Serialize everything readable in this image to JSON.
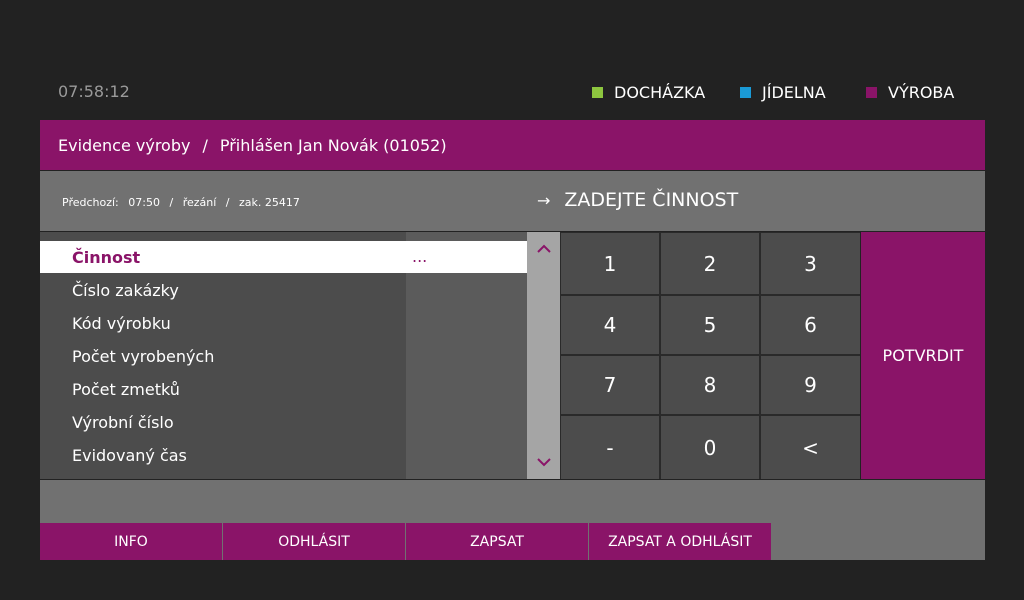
{
  "clock": "07:58:12",
  "modes": [
    {
      "label": "DOCHÁZKA",
      "color": "#8dc63f"
    },
    {
      "label": "JÍDELNA",
      "color": "#1a9ad6"
    },
    {
      "label": "VÝROBA",
      "color": "#8a1468"
    }
  ],
  "header": {
    "section": "Evidence výroby",
    "separator": "/",
    "user": "Přihlášen Jan Novák (01052)"
  },
  "previous": {
    "label": "Předchozí:",
    "time": "07:50",
    "sep": "/",
    "activity": "řezání",
    "order": "zak. 25417"
  },
  "prompt": {
    "arrow": "→",
    "text": "ZADEJTE ČINNOST"
  },
  "fields": [
    {
      "label": "Činnost",
      "value": "..."
    },
    {
      "label": "Číslo zakázky",
      "value": ""
    },
    {
      "label": "Kód výrobku",
      "value": ""
    },
    {
      "label": "Počet vyrobených",
      "value": ""
    },
    {
      "label": "Počet zmetků",
      "value": ""
    },
    {
      "label": "Výrobní číslo",
      "value": ""
    },
    {
      "label": "Evidovaný čas",
      "value": ""
    }
  ],
  "scroll": {
    "up": "⌃",
    "down": "⌄"
  },
  "keypad": [
    "1",
    "2",
    "3",
    "4",
    "5",
    "6",
    "7",
    "8",
    "9",
    "-",
    "0",
    "<"
  ],
  "confirm_label": "POTVRDIT",
  "buttons": [
    "INFO",
    "ODHLÁSIT",
    "ZAPSAT",
    "ZAPSAT A ODHLÁSIT"
  ],
  "colors": {
    "accent": "#8a1468",
    "background": "#222222",
    "panel": "#717171"
  }
}
